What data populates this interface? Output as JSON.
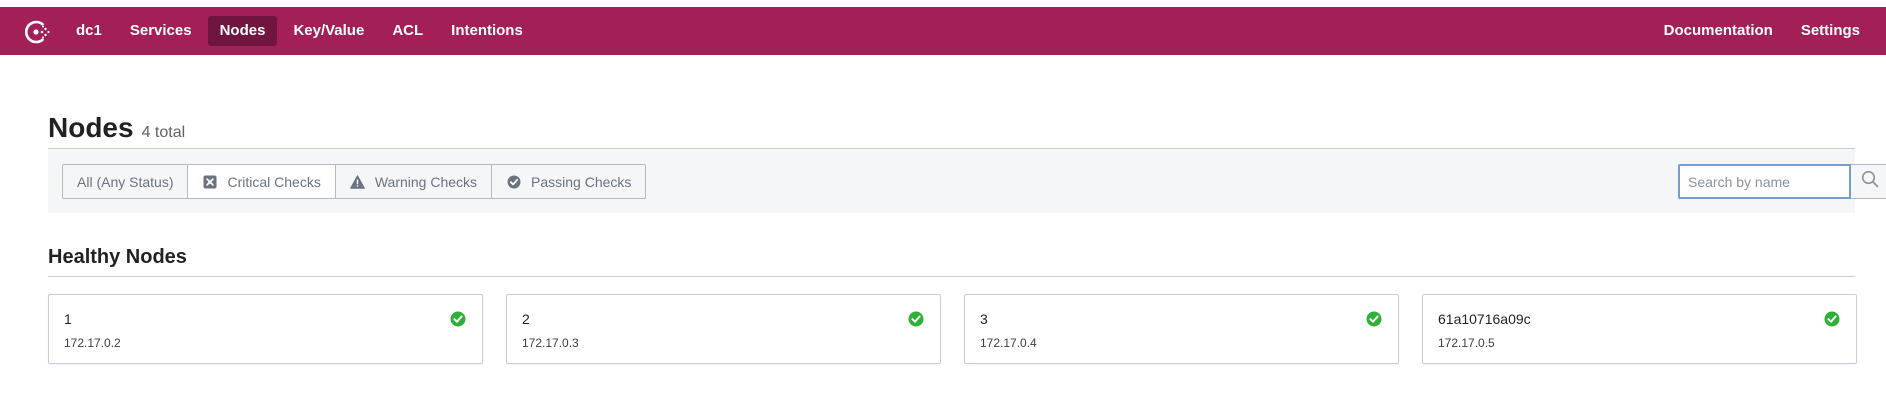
{
  "nav": {
    "left": [
      {
        "label": "dc1",
        "active": false
      },
      {
        "label": "Services",
        "active": false
      },
      {
        "label": "Nodes",
        "active": true
      },
      {
        "label": "Key/Value",
        "active": false
      },
      {
        "label": "ACL",
        "active": false
      },
      {
        "label": "Intentions",
        "active": false
      }
    ],
    "right": [
      {
        "label": "Documentation"
      },
      {
        "label": "Settings"
      }
    ],
    "brand_color": "#a31f58",
    "active_color": "#6f1540"
  },
  "page": {
    "title": "Nodes",
    "count": "4 total"
  },
  "filters": [
    {
      "label": "All (Any Status)",
      "icon": "none",
      "selected": false
    },
    {
      "label": "Critical Checks",
      "icon": "critical-x-icon",
      "selected": true
    },
    {
      "label": "Warning Checks",
      "icon": "warning-triangle-icon",
      "selected": false
    },
    {
      "label": "Passing Checks",
      "icon": "passing-check-icon",
      "selected": false
    }
  ],
  "search": {
    "placeholder": "Search by name",
    "value": ""
  },
  "section": {
    "title": "Healthy Nodes"
  },
  "nodes": [
    {
      "name": "1",
      "address": "172.17.0.2",
      "status": "passing"
    },
    {
      "name": "2",
      "address": "172.17.0.3",
      "status": "passing"
    },
    {
      "name": "3",
      "address": "172.17.0.4",
      "status": "passing"
    },
    {
      "name": "61a10716a09c",
      "address": "172.17.0.5",
      "status": "passing"
    }
  ],
  "colors": {
    "passing": "#2eb039"
  }
}
